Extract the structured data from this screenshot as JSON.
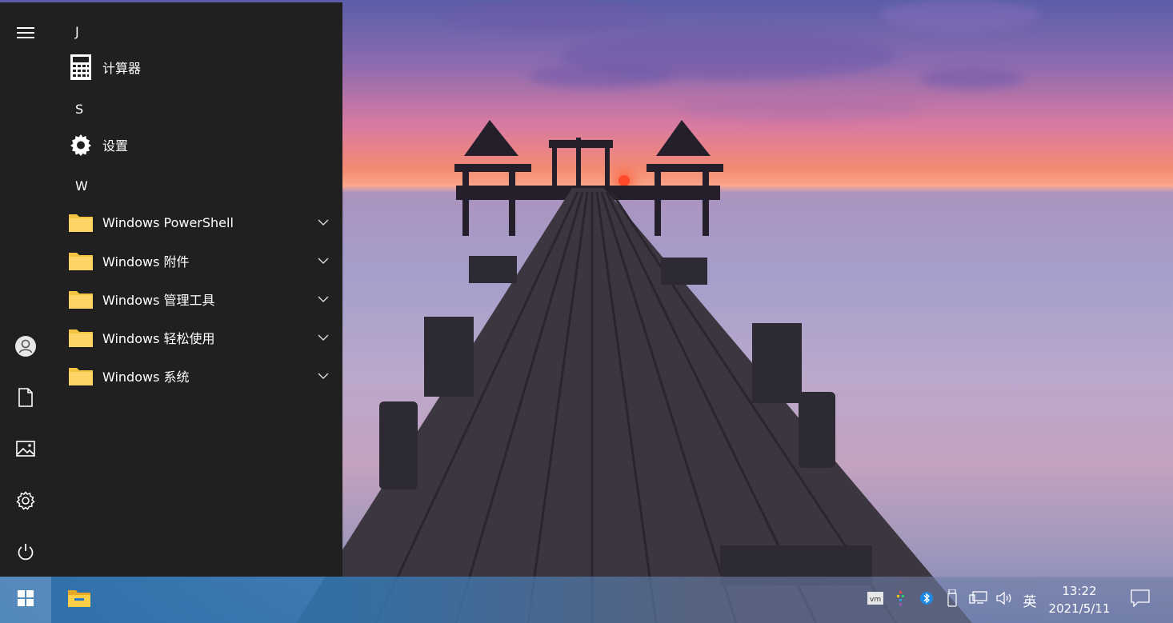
{
  "start_menu": {
    "groups": [
      {
        "letter": "J",
        "items": [
          {
            "label": "计算器",
            "icon": "calculator-icon",
            "expandable": false
          }
        ]
      },
      {
        "letter": "S",
        "items": [
          {
            "label": "设置",
            "icon": "gear-icon",
            "expandable": false
          }
        ]
      },
      {
        "letter": "W",
        "items": [
          {
            "label": "Windows PowerShell",
            "icon": "folder-icon",
            "expandable": true
          },
          {
            "label": "Windows 附件",
            "icon": "folder-icon",
            "expandable": true
          },
          {
            "label": "Windows 管理工具",
            "icon": "folder-icon",
            "expandable": true
          },
          {
            "label": "Windows 轻松使用",
            "icon": "folder-icon",
            "expandable": true
          },
          {
            "label": "Windows 系统",
            "icon": "folder-icon",
            "expandable": true
          }
        ]
      }
    ],
    "rail": [
      "hamburger-menu-icon",
      "user-avatar-icon",
      "documents-icon",
      "pictures-icon",
      "settings-icon",
      "power-icon"
    ]
  },
  "taskbar": {
    "pinned": [
      "windows-start-icon",
      "file-explorer-icon"
    ],
    "tray_icons": [
      "vmware-tray-icon",
      "colorful-tray-icon",
      "bluetooth-icon",
      "usb-device-icon",
      "network-icon",
      "volume-icon"
    ],
    "ime_label": "英",
    "time": "13:22",
    "date": "2021/5/11",
    "notification_icon": "action-center-icon"
  },
  "colors": {
    "start_bg": "#202020",
    "folder_yellow": "#f5c242",
    "taskbar_start_highlight": "#3f7fbf"
  }
}
